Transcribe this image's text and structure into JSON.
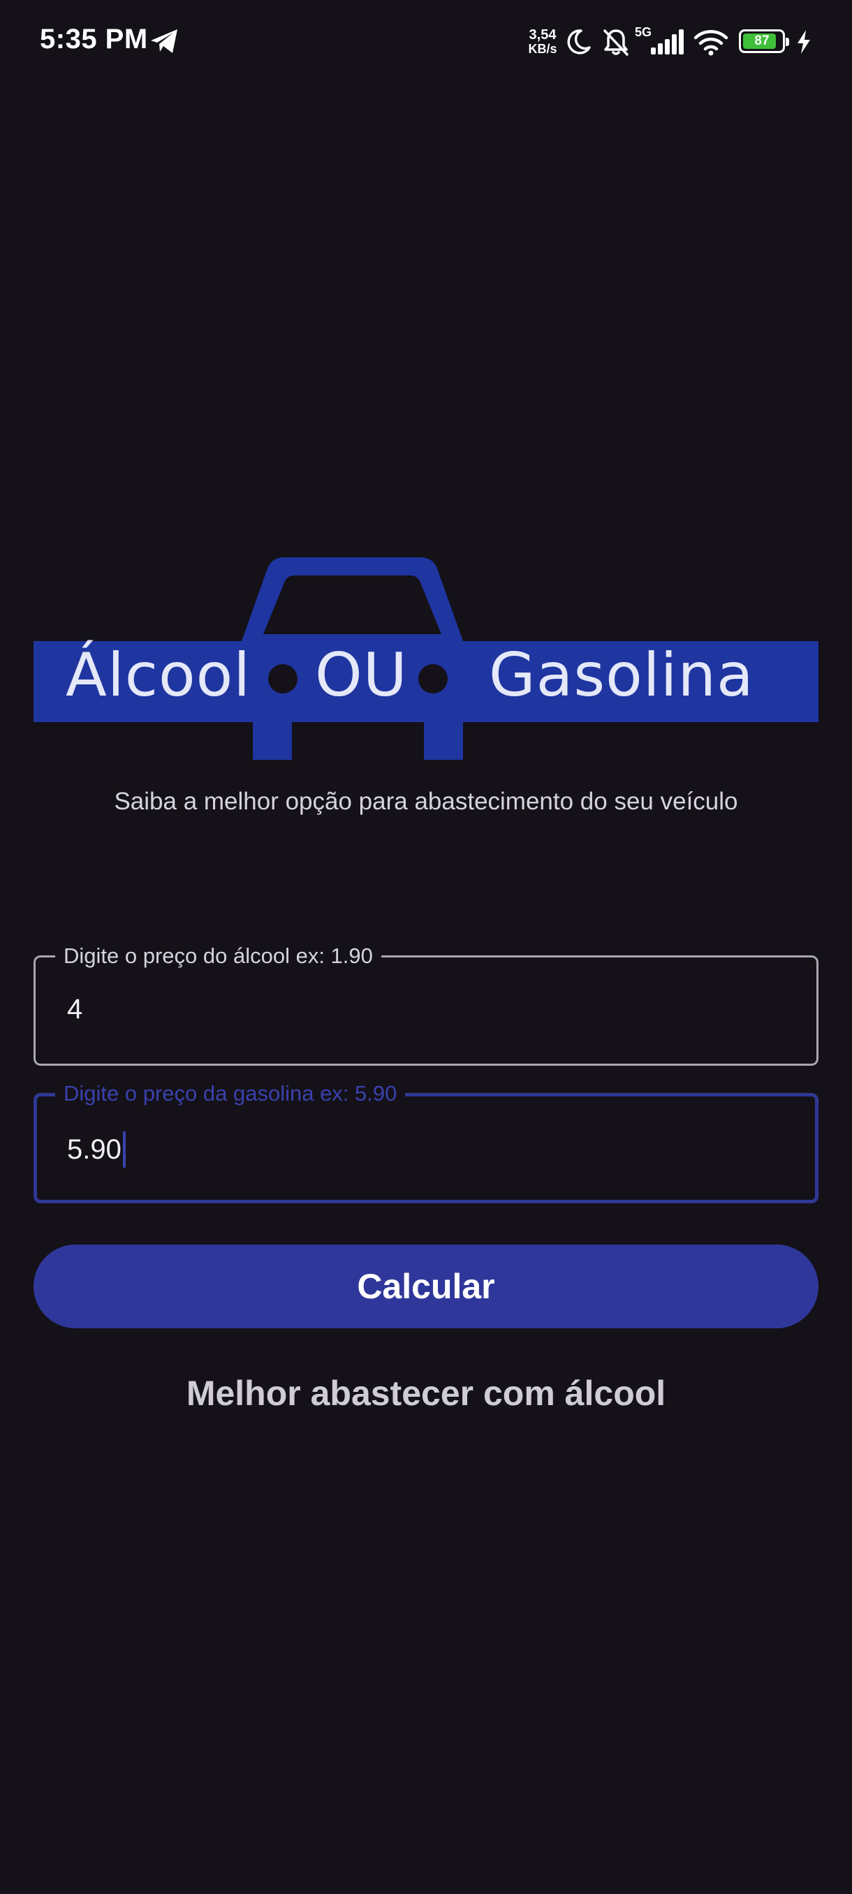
{
  "status_bar": {
    "time": "5:35 PM",
    "net_speed_value": "3,54",
    "net_speed_unit": "KB/s",
    "network_type": "5G",
    "battery_level": "87",
    "battery_fraction": 0.87,
    "icons": [
      "telegram-icon",
      "moon-icon",
      "bell-off-icon",
      "signal-icon",
      "wifi-icon",
      "battery-icon",
      "charging-icon"
    ]
  },
  "logo": {
    "word_left": "Álcool",
    "word_middle": "OU",
    "word_right": "Gasolina",
    "color": "#1f35a0"
  },
  "subtitle": "Saiba a melhor opção para abastecimento do seu veículo",
  "form": {
    "alcool": {
      "label": "Digite o preço do álcool ex: 1.90",
      "value": "4"
    },
    "gasolina": {
      "label": "Digite o preço da gasolina ex: 5.90",
      "value": "5.90",
      "focused": true
    }
  },
  "button": {
    "label": "Calcular"
  },
  "result": "Melhor abastecer com álcool",
  "colors": {
    "background": "#141118",
    "accent": "#30379a",
    "focused_outline": "#303895",
    "logo_blue": "#1f35a0"
  }
}
